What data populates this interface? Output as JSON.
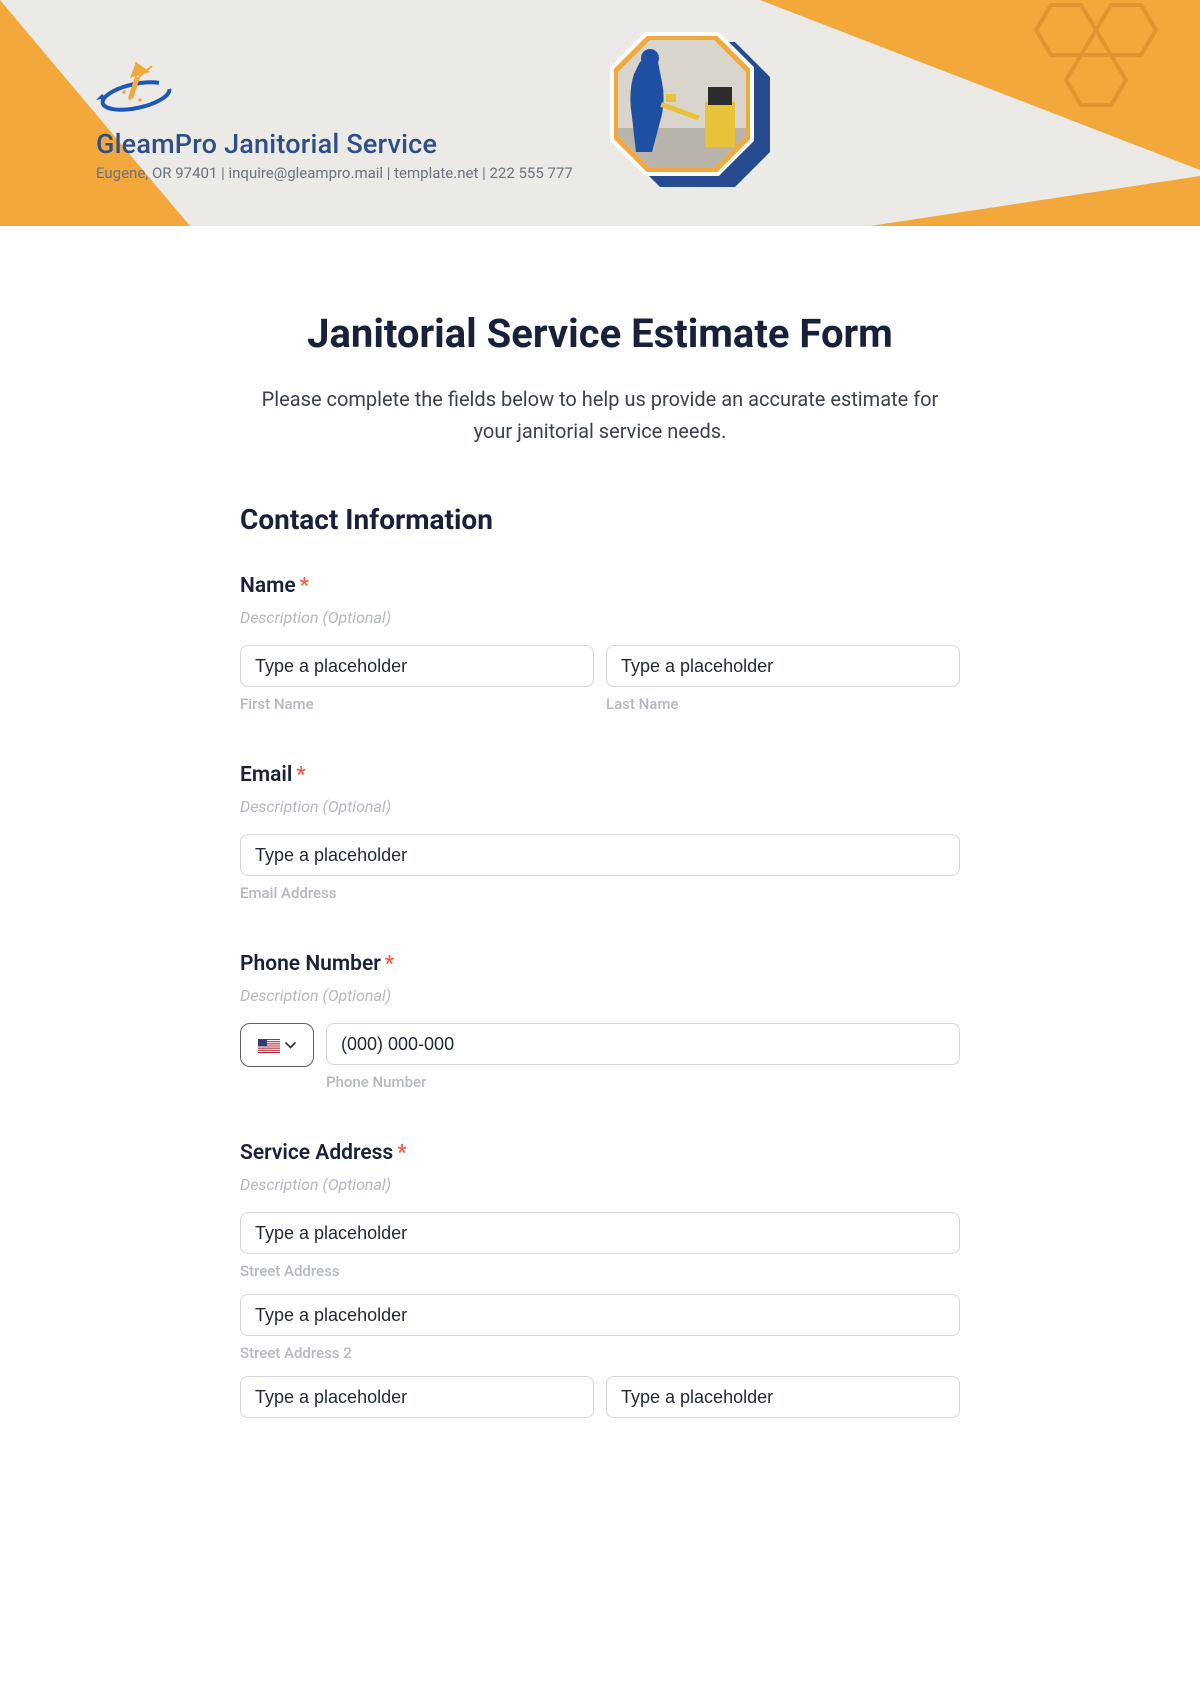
{
  "company": {
    "name": "GleamPro Janitorial Service",
    "meta": "Eugene, OR 97401 | inquire@gleampro.mail | template.net | 222 555 777"
  },
  "form": {
    "title": "Janitorial Service Estimate Form",
    "description": "Please complete the fields below to help us provide an accurate estimate for your janitorial service needs.",
    "section": "Contact Information",
    "name": {
      "label": "Name",
      "hint": "Description (Optional)",
      "first_ph": "Type a placeholder",
      "last_ph": "Type a placeholder",
      "first_sub": "First Name",
      "last_sub": "Last Name"
    },
    "email": {
      "label": "Email",
      "hint": "Description (Optional)",
      "ph": "Type a placeholder",
      "sub": "Email Address"
    },
    "phone": {
      "label": "Phone Number",
      "hint": "Description (Optional)",
      "ph": "(000) 000-000",
      "sub": "Phone Number"
    },
    "address": {
      "label": "Service Address",
      "hint": "Description (Optional)",
      "street_ph": "Type a placeholder",
      "street_sub": "Street Address",
      "street2_ph": "Type a placeholder",
      "street2_sub": "Street Address 2",
      "city_ph": "Type a placeholder",
      "state_ph": "Type a placeholder"
    }
  }
}
